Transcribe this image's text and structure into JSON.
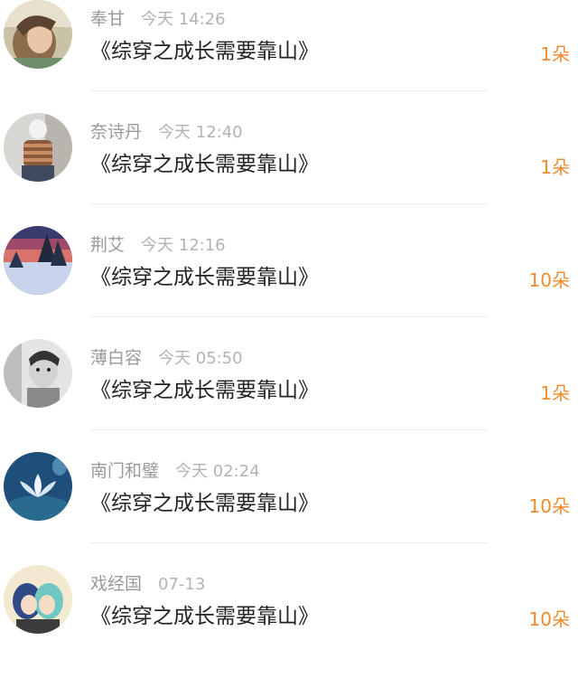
{
  "colors": {
    "name": "#9a9a9a",
    "time": "#b3b3b3",
    "title": "#222222",
    "gift": "#f08a2c",
    "divider": "#efefef"
  },
  "items": [
    {
      "name": "奉甘",
      "time": "今天 14:26",
      "title": "《综穿之成长需要靠山》",
      "gift": "1朵",
      "avatar": "avatar-girl-photo"
    },
    {
      "name": "奈诗丹",
      "time": "今天 12:40",
      "title": "《综穿之成长需要靠山》",
      "gift": "1朵",
      "avatar": "avatar-person-striped-sweater"
    },
    {
      "name": "荆艾",
      "time": "今天 12:16",
      "title": "《综穿之成长需要靠山》",
      "gift": "10朵",
      "avatar": "avatar-winter-sunset"
    },
    {
      "name": "薄白容",
      "time": "今天 05:50",
      "title": "《综穿之成长需要靠山》",
      "gift": "1朵",
      "avatar": "avatar-child-bw"
    },
    {
      "name": "南门和璧",
      "time": "今天 02:24",
      "title": "《综穿之成长需要靠山》",
      "gift": "10朵",
      "avatar": "avatar-lotus-blue"
    },
    {
      "name": "戏经国",
      "time": "07-13",
      "title": "《综穿之成长需要靠山》",
      "gift": "10朵",
      "avatar": "avatar-anime-pair"
    }
  ]
}
